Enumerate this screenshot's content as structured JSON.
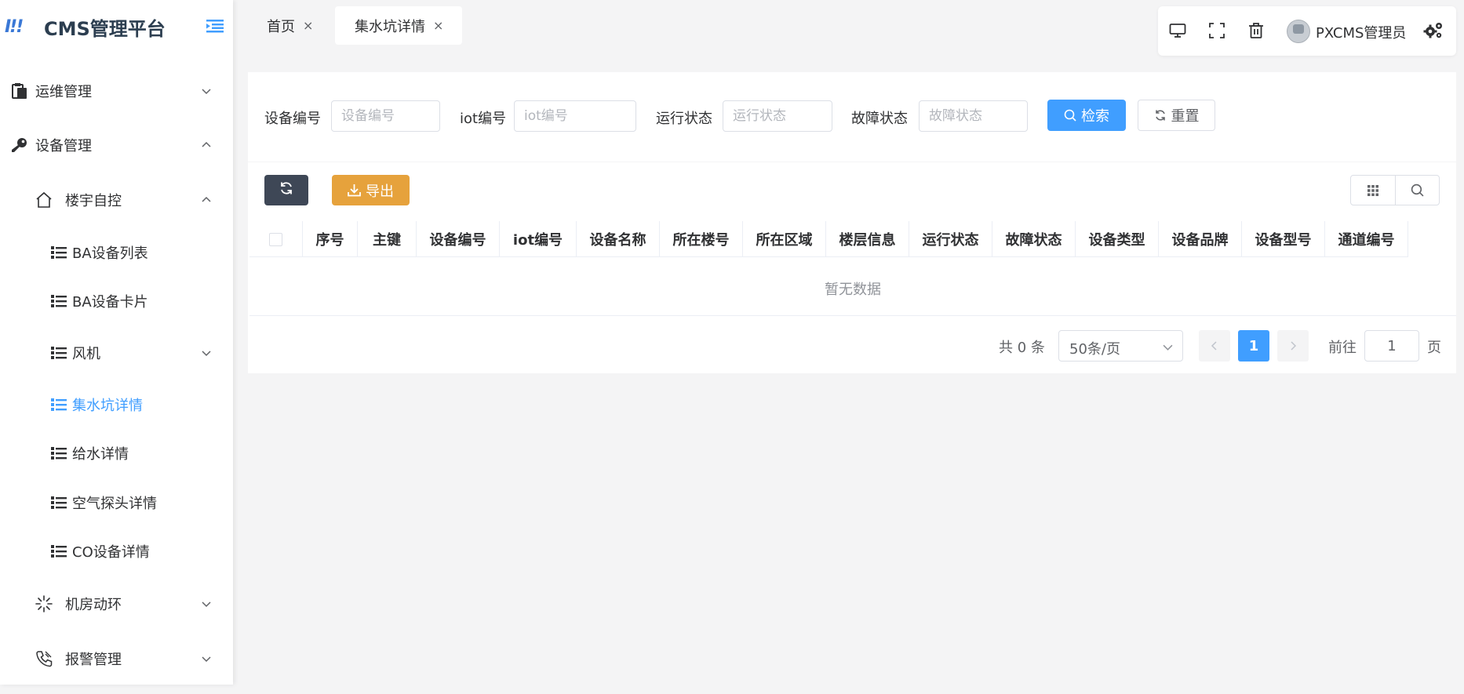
{
  "app": {
    "logo_mark": "I!!",
    "title": "CMS管理平台"
  },
  "sidebar": {
    "items": [
      {
        "label": "运维管理",
        "icon": "clipboard-icon",
        "chevron": "down"
      },
      {
        "label": "设备管理",
        "icon": "key-icon",
        "chevron": "up"
      },
      {
        "label": "楼宇自控",
        "icon": "home-icon",
        "chevron": "up"
      },
      {
        "label": "BA设备列表",
        "icon": "list-icon"
      },
      {
        "label": "BA设备卡片",
        "icon": "list-icon"
      },
      {
        "label": "风机",
        "icon": "list-icon",
        "chevron": "down"
      },
      {
        "label": "集水坑详情",
        "icon": "list-icon",
        "active": true
      },
      {
        "label": "给水详情",
        "icon": "list-icon"
      },
      {
        "label": "空气探头详情",
        "icon": "list-icon"
      },
      {
        "label": "CO设备详情",
        "icon": "list-icon"
      },
      {
        "label": "机房动环",
        "icon": "spinner-icon",
        "chevron": "down"
      },
      {
        "label": "报警管理",
        "icon": "phone-icon",
        "chevron": "down"
      }
    ]
  },
  "tabs": [
    {
      "label": "首页",
      "close": "×"
    },
    {
      "label": "集水坑详情",
      "close": "×",
      "active": true
    }
  ],
  "header": {
    "username": "PXCMS管理员"
  },
  "search": {
    "fields": [
      {
        "label": "设备编号",
        "placeholder": "设备编号"
      },
      {
        "label": "iot编号",
        "placeholder": "iot编号"
      },
      {
        "label": "运行状态",
        "placeholder": "运行状态"
      },
      {
        "label": "故障状态",
        "placeholder": "故障状态"
      }
    ],
    "search_label": "检索",
    "reset_label": "重置"
  },
  "toolbar": {
    "export_label": "导出"
  },
  "table": {
    "columns": [
      "序号",
      "主键",
      "设备编号",
      "iot编号",
      "设备名称",
      "所在楼号",
      "所在区域",
      "楼层信息",
      "运行状态",
      "故障状态",
      "设备类型",
      "设备品牌",
      "设备型号",
      "通道编号"
    ],
    "empty_text": "暂无数据"
  },
  "pagination": {
    "total_text": "共 0 条",
    "page_size": "50条/页",
    "current_page": "1",
    "goto_label": "前往",
    "goto_value": "1",
    "page_suffix": "页"
  },
  "colors": {
    "primary": "#409eff",
    "warning": "#e6a23c",
    "dark": "#3e4756"
  }
}
